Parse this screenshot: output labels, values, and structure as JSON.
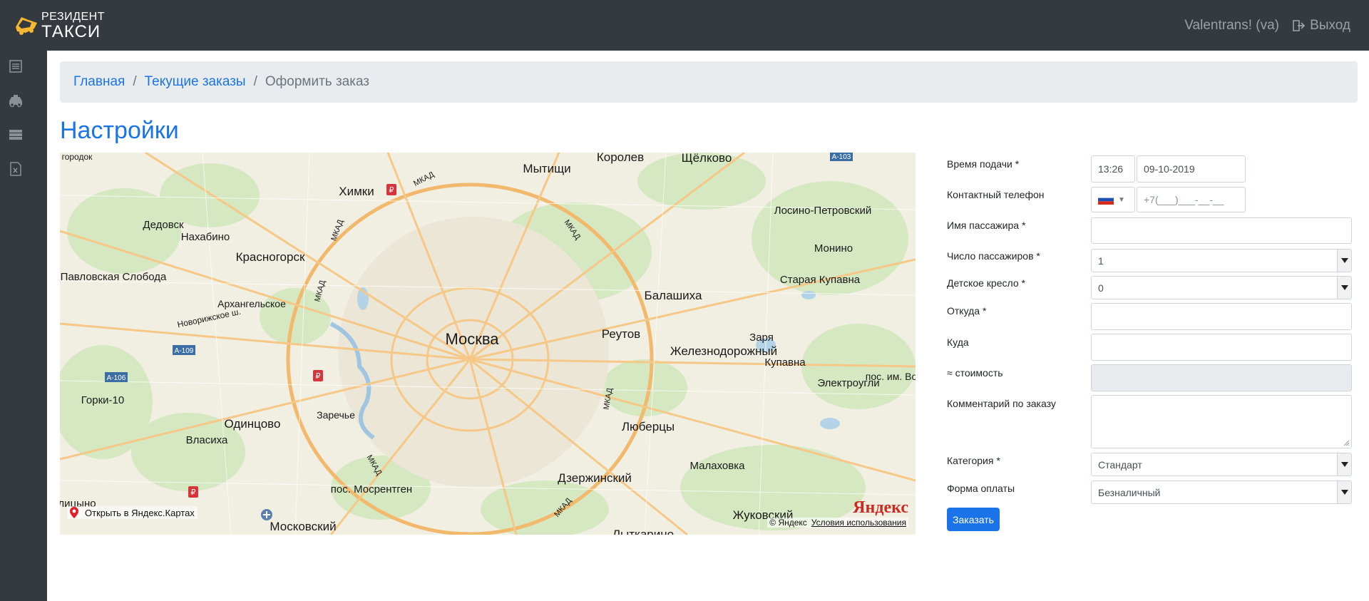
{
  "brand": {
    "line1": "РЕЗИДЕНТ",
    "line2": "ТАКСИ"
  },
  "header": {
    "user": "Valentrans! (va)",
    "logout": "Выход"
  },
  "sidebar": {
    "icons": [
      "list-icon",
      "taxi-icon",
      "server-icon",
      "excel-icon"
    ]
  },
  "breadcrumb": {
    "home": "Главная",
    "current_orders": "Текущие заказы",
    "current": "Оформить заказ",
    "separator": "/"
  },
  "page": {
    "title": "Настройки"
  },
  "map": {
    "labels": {
      "moscow": "Москва",
      "mytishchi": "Мытищи",
      "korolev": "Королев",
      "shchelkovo": "Щёлково",
      "khimki": "Химки",
      "losino": "Лосино-Петровский",
      "dedovsk": "Дедовск",
      "nakhabino": "Нахабино",
      "krasnogorsk": "Красногорск",
      "monino": "Монино",
      "pavlovskaya": "Павловская Слобода",
      "staraya_kupavna": "Старая Купавна",
      "arkhangelskoe": "Архангельское",
      "balashikha": "Балашиха",
      "reutov": "Реутов",
      "zheleznodorozhny": "Железнодорожный",
      "zarya": "Заря",
      "kupavna": "Купавна",
      "elektrougli": "Электроугли",
      "gorki": "Горки-10",
      "odintsovo": "Одинцово",
      "zarechye": "Заречье",
      "lyubertsy": "Люберцы",
      "vlasikha": "Власиха",
      "malakhovka": "Малаховка",
      "dzerzhinsky": "Дзержинский",
      "mosrentgen": "пос. Мосрентген",
      "zhukovsky": "Жуковский",
      "moskovsky": "Московский",
      "lytkarino": "Лыткарино",
      "gorodok": "городок",
      "olitsyno": "олицыно",
      "pos_im": "пос. им. Во",
      "novorizhskoe": "Новорижское ш.",
      "mkad": "МКАД",
      "a109": "А-109",
      "a106": "А-106",
      "a103": "А-103"
    },
    "open_link": "Открыть в Яндекс.Картах",
    "copyright": "© Яндекс",
    "terms": "Условия использования",
    "logo": "Яндекс"
  },
  "form": {
    "pickup_time_label": "Время подачи *",
    "pickup_time": "13:26",
    "pickup_date": "09-10-2019",
    "phone_label": "Контактный телефон",
    "phone_placeholder": "+7(___)___-__-__",
    "passenger_name_label": "Имя пассажира *",
    "passenger_name": "",
    "passengers_count_label": "Число пассажиров *",
    "passengers_count": "1",
    "child_seat_label": "Детское кресло *",
    "child_seat": "0",
    "from_label": "Откуда *",
    "from": "",
    "to_label": "Куда",
    "to": "",
    "cost_label": "≈ стоимость",
    "cost": "",
    "comment_label": "Комментарий по заказу",
    "comment": "",
    "category_label": "Категория *",
    "category": "Стандарт",
    "payment_label": "Форма оплаты",
    "payment": "Безналичный",
    "submit": "Заказать"
  }
}
